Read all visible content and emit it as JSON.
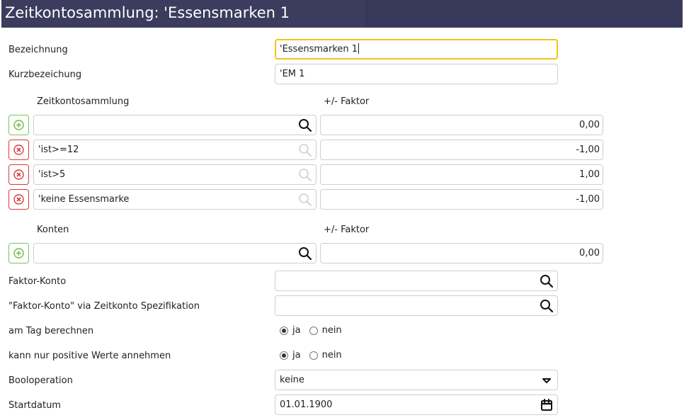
{
  "window": {
    "title": "Zeitkontosammlung: 'Essensmarken 1"
  },
  "bezeichnung": {
    "label": "Bezeichnung",
    "value": "'Essensmarken 1"
  },
  "kurzbezeichnung": {
    "label": "Kurzbezeichung",
    "value": "'EM 1"
  },
  "sammlung": {
    "col_left": "Zeitkontosammlung",
    "col_right": "+/- Faktor",
    "new_row": {
      "name": "",
      "factor": "0,00"
    },
    "rows": [
      {
        "name": "'ist>=12",
        "factor": "-1,00"
      },
      {
        "name": "'ist>5",
        "factor": "1,00"
      },
      {
        "name": "'keine Essensmarke",
        "factor": "-1,00"
      }
    ]
  },
  "konten": {
    "col_left": "Konten",
    "col_right": "+/- Faktor",
    "new_row": {
      "name": "",
      "factor": "0,00"
    }
  },
  "faktor_konto": {
    "label": "Faktor-Konto",
    "value": ""
  },
  "faktor_konto_spez": {
    "label": "\"Faktor-Konto\" via Zeitkonto Spezifikation",
    "value": ""
  },
  "am_tag": {
    "label": "am Tag berechnen",
    "options": [
      "ja",
      "nein"
    ],
    "selected": "ja"
  },
  "nur_positiv": {
    "label": "kann nur positive Werte annehmen",
    "options": [
      "ja",
      "nein"
    ],
    "selected": "ja"
  },
  "booloperation": {
    "label": "Booloperation",
    "value": "keine"
  },
  "startdatum": {
    "label": "Startdatum",
    "value": "01.01.1900"
  },
  "colors": {
    "title_bg": "#3c3c5e",
    "focus_border": "#f0c419",
    "add_green": "#7ec35a",
    "remove_red": "#d93a3a"
  },
  "icons": {
    "search": "search-icon",
    "add": "plus-circle-icon",
    "remove": "x-circle-icon",
    "dropdown": "caret-down-icon",
    "calendar": "calendar-icon"
  }
}
